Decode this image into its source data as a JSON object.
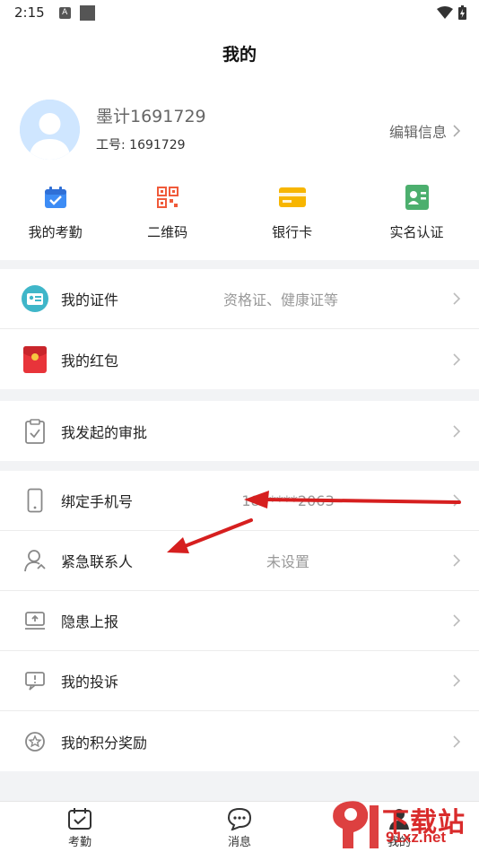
{
  "status_bar": {
    "time": "2:15"
  },
  "header": {
    "title": "我的"
  },
  "profile": {
    "name": "墨计1691729",
    "id_label": "工号:",
    "id_value": "1691729",
    "edit_label": "编辑信息"
  },
  "quick_actions": [
    {
      "label": "我的考勤",
      "icon": "attendance-icon",
      "color": "#3d8cf5"
    },
    {
      "label": "二维码",
      "icon": "qr-code-icon",
      "color": "#f05a3a"
    },
    {
      "label": "银行卡",
      "icon": "bank-card-icon",
      "color": "#f7b500"
    },
    {
      "label": "实名认证",
      "icon": "id-verify-icon",
      "color": "#4caf6e"
    }
  ],
  "groups": [
    [
      {
        "label": "我的证件",
        "value": "资格证、健康证等",
        "icon": "certificate-icon"
      },
      {
        "label": "我的红包",
        "value": "",
        "icon": "red-packet-icon"
      }
    ],
    [
      {
        "label": "我发起的审批",
        "value": "",
        "icon": "clipboard-icon"
      }
    ],
    [
      {
        "label": "绑定手机号",
        "value": "183****2063",
        "icon": "phone-icon"
      },
      {
        "label": "紧急联系人",
        "value": "未设置",
        "icon": "contact-icon"
      },
      {
        "label": "隐患上报",
        "value": "",
        "icon": "report-icon"
      },
      {
        "label": "我的投诉",
        "value": "",
        "icon": "complaint-icon"
      },
      {
        "label": "我的积分奖励",
        "value": "",
        "icon": "points-icon"
      }
    ]
  ],
  "tabs": [
    {
      "label": "考勤",
      "icon": "attendance-tab-icon"
    },
    {
      "label": "消息",
      "icon": "message-tab-icon"
    },
    {
      "label": "我的",
      "icon": "profile-tab-icon"
    }
  ],
  "watermark": {
    "brand": "下载站",
    "url": "91xz.net"
  },
  "colors": {
    "annotation_arrow": "#d61f1f",
    "watermark": "#d92b2b"
  }
}
